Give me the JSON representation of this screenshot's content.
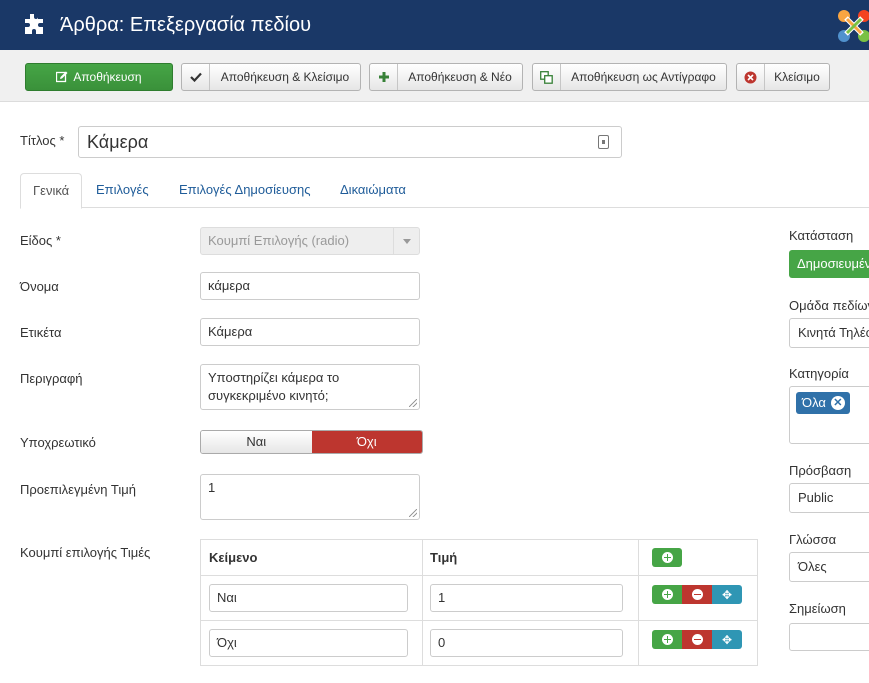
{
  "header": {
    "title": "Άρθρα: Επεξεργασία πεδίου"
  },
  "toolbar": {
    "save": "Αποθήκευση",
    "save_close": "Αποθήκευση & Κλείσιμο",
    "save_new": "Αποθήκευση & Νέο",
    "save_copy": "Αποθήκευση ως Αντίγραφο",
    "close": "Κλείσιμο"
  },
  "title_field": {
    "label": "Τίτλος *",
    "value": "Κάμερα"
  },
  "tabs": [
    "Γενικά",
    "Επιλογές",
    "Επιλογές Δημοσίευσης",
    "Δικαιώματα"
  ],
  "form": {
    "type": {
      "label": "Είδος *",
      "value": "Κουμπί Επιλογής (radio)"
    },
    "name": {
      "label": "Όνομα",
      "value": "κάμερα"
    },
    "field_label": {
      "label": "Ετικέτα",
      "value": "Κάμερα"
    },
    "description": {
      "label": "Περιγραφή",
      "line1": "Υποστηρίζει κάμερα το",
      "line2": "συγκεκριμένο κινητό;"
    },
    "required": {
      "label": "Υποχρεωτικό",
      "yes": "Ναι",
      "no": "Όχι",
      "selected": "Όχι"
    },
    "default": {
      "label": "Προεπιλεγμένη Τιμή",
      "value": "1"
    },
    "radio_values": {
      "label": "Κουμπί επιλογής Τιμές",
      "col_text": "Κείμενο",
      "col_value": "Τιμή",
      "rows": [
        {
          "text": "Ναι",
          "value": "1"
        },
        {
          "text": "Όχι",
          "value": "0"
        }
      ]
    }
  },
  "sidebar": {
    "status": {
      "label": "Κατάσταση",
      "value": "Δημοσιευμένο"
    },
    "group": {
      "label": "Ομάδα πεδίων",
      "value": "Κινητά Τηλέφωνα"
    },
    "category": {
      "label": "Κατηγορία",
      "chip": "Όλα"
    },
    "access": {
      "label": "Πρόσβαση",
      "value": "Public"
    },
    "language": {
      "label": "Γλώσσα",
      "value": "Όλες"
    },
    "note": {
      "label": "Σημείωση",
      "value": ""
    }
  },
  "colors": {
    "header": "#1a3867",
    "save": "#46a546",
    "danger": "#bd362f",
    "info": "#2f96b4",
    "chip": "#3071a9"
  }
}
